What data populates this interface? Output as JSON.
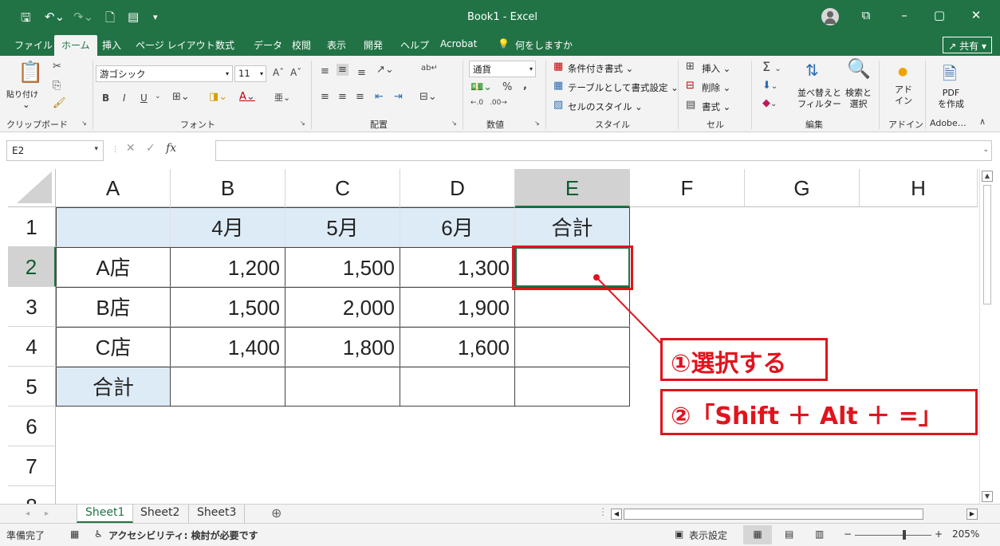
{
  "titlebar": {
    "title": "Book1  -  Excel",
    "quick_access": [
      "save-icon",
      "undo-icon",
      "redo-icon",
      "new-icon",
      "form-icon"
    ],
    "share_label": "共有"
  },
  "menu": {
    "tabs": [
      "ファイル",
      "ホーム",
      "挿入",
      "ページ レイアウト",
      "数式",
      "データ",
      "校閲",
      "表示",
      "開発",
      "ヘルプ",
      "Acrobat",
      "何をしますか"
    ],
    "active": "ホーム"
  },
  "ribbon": {
    "clipboard": {
      "paste": "貼り付け",
      "label": "クリップボード"
    },
    "font": {
      "name": "游ゴシック",
      "size": "11",
      "label": "フォント",
      "bold": "B",
      "italic": "I",
      "underline": "U",
      "font_color": "A"
    },
    "alignment": {
      "label": "配置"
    },
    "number": {
      "format": "通貨",
      "percent": "%",
      "comma": ",",
      "label": "数値"
    },
    "styles": {
      "conditional": "条件付き書式",
      "table": "テーブルとして書式設定",
      "cell_styles": "セルのスタイル",
      "label": "スタイル"
    },
    "cells": {
      "insert": "挿入",
      "delete": "削除",
      "format": "書式",
      "label": "セル"
    },
    "editing": {
      "sort": "並べ替えと\nフィルター",
      "find": "検索と\n選択",
      "label": "編集",
      "sigma": "Σ"
    },
    "addins": {
      "button": "アド\nイン",
      "label": "アドイン"
    },
    "adobe": {
      "button": "PDF\nを作成",
      "label": "Adobe…"
    }
  },
  "formula_bar": {
    "name_box": "E2",
    "fx": "fx",
    "value": ""
  },
  "sheet": {
    "columns": [
      "A",
      "B",
      "C",
      "D",
      "E",
      "F",
      "G",
      "H"
    ],
    "rows": [
      "1",
      "2",
      "3",
      "4",
      "5",
      "6",
      "7",
      "8"
    ],
    "selected_col": "E",
    "selected_row": "2",
    "cells": {
      "B1": "4月",
      "C1": "5月",
      "D1": "6月",
      "E1": "合計",
      "A2": "A店",
      "B2": "1,200",
      "C2": "1,500",
      "D2": "1,300",
      "A3": "B店",
      "B3": "1,500",
      "C3": "2,000",
      "D3": "1,900",
      "A4": "C店",
      "B4": "1,400",
      "C4": "1,800",
      "D4": "1,600",
      "A5": "合計"
    }
  },
  "sheet_tabs": [
    "Sheet1",
    "Sheet2",
    "Sheet3"
  ],
  "active_sheet": "Sheet1",
  "status": {
    "ready": "準備完了",
    "accessibility": "アクセシビリティ: 検討が必要です",
    "display_settings": "表示設定",
    "zoom": "205%"
  },
  "annotations": {
    "step1": "①選択する",
    "step2": "②「Shift ＋ Alt ＋ =」",
    "color": "#e0141e"
  }
}
